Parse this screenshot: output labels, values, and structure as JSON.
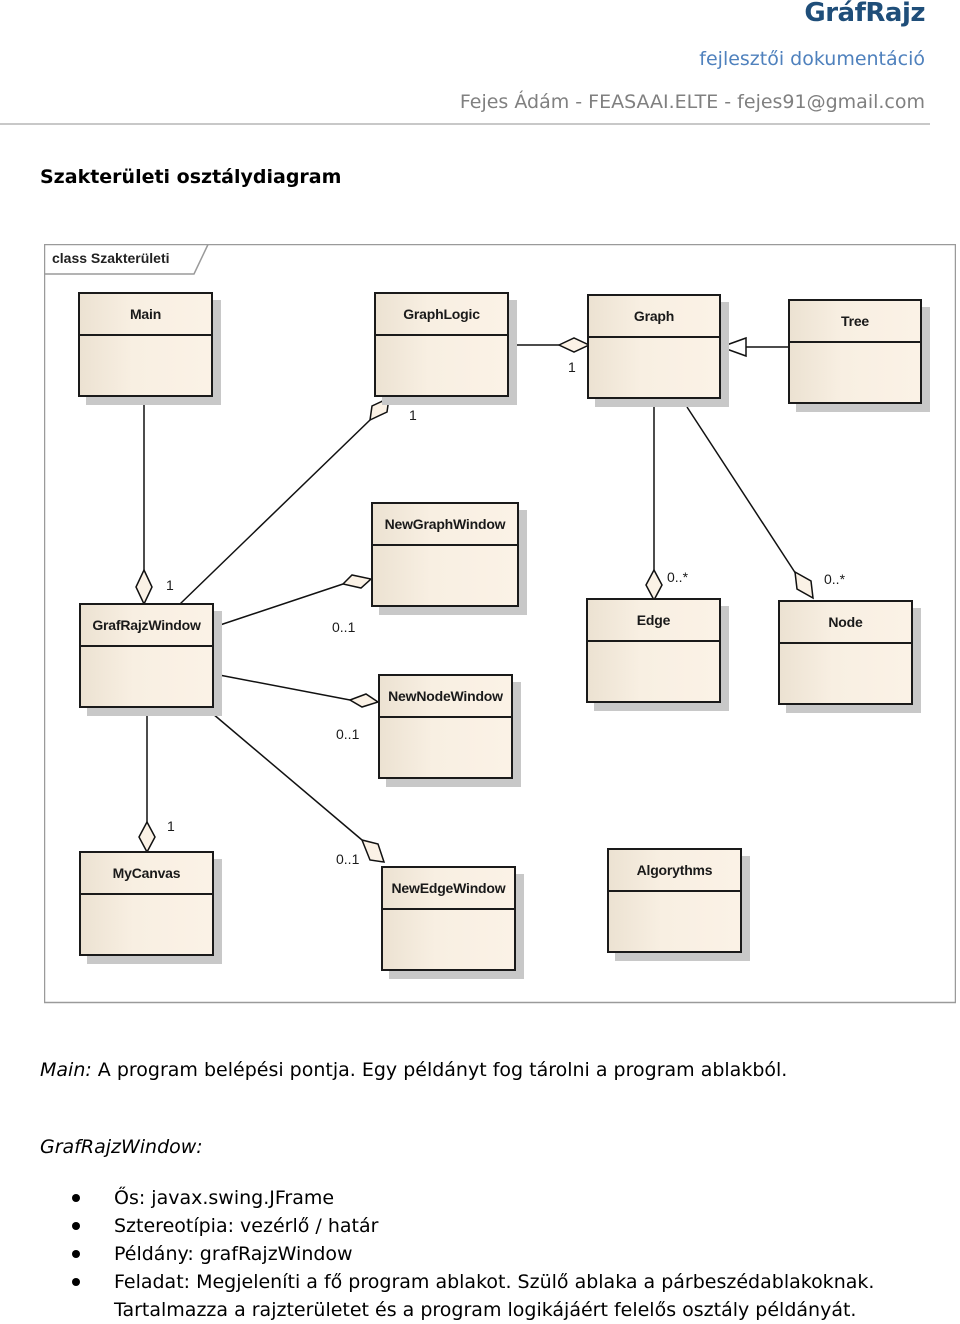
{
  "header": {
    "title": "GráfRajz",
    "subtitle": "fejlesztői dokumentáció",
    "author_line": "Fejes Ádám - FEASAAI.ELTE - fejes91@gmail.com"
  },
  "section_title": "Szakterületi osztálydiagram",
  "diagram": {
    "frame_label": "class Szakterületi",
    "classes": {
      "main": "Main",
      "graphlogic": "GraphLogic",
      "graph": "Graph",
      "tree": "Tree",
      "newgraphwindow": "NewGraphWindow",
      "grafrajzwindow": "GrafRajzWindow",
      "edge": "Edge",
      "node": "Node",
      "newnodewindow": "NewNodeWindow",
      "mycanvas": "MyCanvas",
      "newedgewindow": "NewEdgeWindow",
      "algorythms": "Algorythms"
    },
    "relations": [
      {
        "from": "GraphLogic",
        "to": "Graph",
        "type": "aggregation",
        "multiplicity": "1"
      },
      {
        "from": "Tree",
        "to": "Graph",
        "type": "generalization"
      },
      {
        "from": "GrafRajzWindow",
        "to": "GraphLogic",
        "type": "aggregation",
        "multiplicity": "1"
      },
      {
        "from": "Main",
        "to": "GrafRajzWindow",
        "type": "aggregation",
        "multiplicity": "1"
      },
      {
        "from": "GrafRajzWindow",
        "to": "NewGraphWindow",
        "type": "aggregation",
        "multiplicity": "0..1"
      },
      {
        "from": "Graph",
        "to": "Edge",
        "type": "aggregation",
        "multiplicity": "0..*"
      },
      {
        "from": "Graph",
        "to": "Node",
        "type": "aggregation",
        "multiplicity": "0..*"
      },
      {
        "from": "GrafRajzWindow",
        "to": "NewNodeWindow",
        "type": "aggregation",
        "multiplicity": "0..1"
      },
      {
        "from": "GrafRajzWindow",
        "to": "MyCanvas",
        "type": "aggregation",
        "multiplicity": "1"
      },
      {
        "from": "GrafRajzWindow",
        "to": "NewEdgeWindow",
        "type": "aggregation",
        "multiplicity": "0..1"
      }
    ],
    "multiplicities": {
      "graphlogic_graph": "1",
      "grafrajz_graphlogic": "1",
      "main_grafrajz": "1",
      "newgraph": "0..1",
      "edge": "0..*",
      "node": "0..*",
      "newnode": "0..1",
      "mycanvas": "1",
      "newedge": "0..1"
    }
  },
  "main_desc": {
    "label": "Main:",
    "text": " A program belépési pontja. Egy példányt fog tárolni a program ablakból."
  },
  "grafrajz_desc": {
    "label": "GrafRajzWindow:",
    "bullets": [
      "Ős: javax.swing.JFrame",
      "Sztereotípia: vezérlő / határ",
      "Példány: grafRajzWindow",
      "Feladat: Megjeleníti a fő program ablakot. Szülő ablaka a párbeszédablakoknak."
    ],
    "bullet_continuation": "Tartalmazza a rajzterületet és a program logikájáért felelős osztály példányát."
  }
}
